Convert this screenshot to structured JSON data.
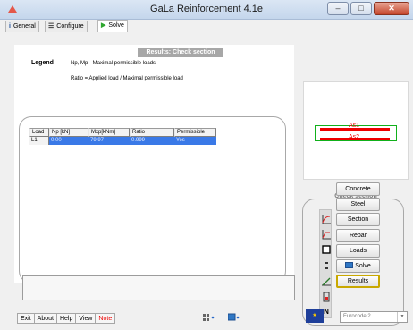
{
  "window": {
    "title": "GaLa Reinforcement  4.1e",
    "minimize_glyph": "–",
    "maximize_glyph": "□",
    "close_glyph": "✕"
  },
  "tabs": [
    {
      "label": "General",
      "icon": "info-icon",
      "glyph": "i"
    },
    {
      "label": "Configure",
      "icon": "configure-icon",
      "glyph": "☰"
    },
    {
      "label": "Solve",
      "icon": "play-icon",
      "glyph": "▶"
    }
  ],
  "results": {
    "header": "Results: Check section",
    "legend_title": "Legend",
    "legend_line1": "Np, Mp  - Maximal permissible loads",
    "legend_line2": "Ratio  =  Applied load / Maximal permissible load",
    "columns": [
      "Load",
      "Np [kN]",
      "Mxp[kNm]",
      "Ratio",
      "Permissible"
    ],
    "rows": [
      {
        "load": "L1",
        "np": "0.00",
        "mxp": "79.97",
        "ratio": "0.999",
        "permissible": "Yes"
      }
    ]
  },
  "preview": {
    "label_top": "As1",
    "label_bottom": "As2",
    "colors": {
      "outline": "#11b01b",
      "rebar": "#e00000"
    }
  },
  "check_section": {
    "title": "Check section",
    "buttons": [
      "Concrete",
      "Steel",
      "Section",
      "Rebar",
      "Loads",
      "Solve",
      "Results"
    ],
    "selected": "Results",
    "side_icons": [
      "stress-strain-icon",
      "stress-strain-icon",
      "rectangle-section-icon",
      "rebar-layers-icon",
      "loads-icon",
      "solver-icon",
      "normal-force-icon"
    ],
    "normal_force_glyph": "N"
  },
  "bottom": {
    "buttons": [
      "Exit",
      "About",
      "Help",
      "View",
      "Note"
    ],
    "code_label": "Eurocode 2",
    "dropdown_glyph": "▾"
  }
}
